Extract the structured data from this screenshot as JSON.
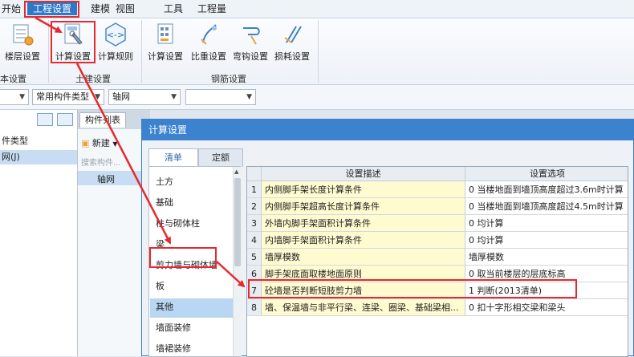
{
  "menubar": {
    "items": [
      "开始",
      "工程设置",
      "建模",
      "视图",
      "工具",
      "工程量"
    ]
  },
  "ribbon": {
    "buttons": [
      "楼层设置",
      "计算设置",
      "计算规则",
      "计算设置",
      "比重设置",
      "弯钩设置",
      "损耗设置"
    ],
    "groups": [
      "本设置",
      "土建设置",
      "钢筋设置"
    ]
  },
  "toolbar": {
    "combo_type": "常用构件类型",
    "combo_axis": "轴网"
  },
  "left_panel": {
    "rows": [
      "件类型",
      "网(J)"
    ]
  },
  "component_list": {
    "tab": "构件列表",
    "new_label": "新建",
    "search_placeholder": "搜索构件...",
    "item": "轴网"
  },
  "dialog": {
    "title": "计算设置",
    "tabs": [
      "清单",
      "定额"
    ],
    "categories": [
      "土方",
      "基础",
      "柱与砌体柱",
      "梁",
      "剪力墙与砌体墙",
      "板",
      "其他",
      "墙面装修",
      "墙裙装修"
    ],
    "selected_category": 4,
    "columns": [
      "设置描述",
      "设置选项"
    ],
    "rows": [
      {
        "num": "1",
        "desc": "内侧脚手架长度计算条件",
        "option": "0 当楼地面到墙顶高度超过3.6m时计算"
      },
      {
        "num": "2",
        "desc": "内侧脚手架超高长度计算条件",
        "option": "0 当楼地面到墙顶高度超过4.5m时计算"
      },
      {
        "num": "3",
        "desc": "外墙内脚手架面积计算条件",
        "option": "0 均计算"
      },
      {
        "num": "4",
        "desc": "内墙脚手架面积计算条件",
        "option": "0 均计算"
      },
      {
        "num": "5",
        "desc": "墙厚模数",
        "option": "墙厚模数"
      },
      {
        "num": "6",
        "desc": "脚手架底面取楼地面原则",
        "option": "0 取当前楼层的层底标高"
      },
      {
        "num": "7",
        "desc": "砼墙是否判断短肢剪力墙",
        "option": "1 判断(2013清单)"
      },
      {
        "num": "8",
        "desc": "墙、保温墙与非平行梁、连梁、圈梁、基础梁相...",
        "option": "0 扣十字形相交梁和梁头"
      }
    ]
  },
  "colors": {
    "accent": "#2f78c8",
    "highlight": "#e8282e",
    "cell_yellow": "#fffbd0"
  }
}
